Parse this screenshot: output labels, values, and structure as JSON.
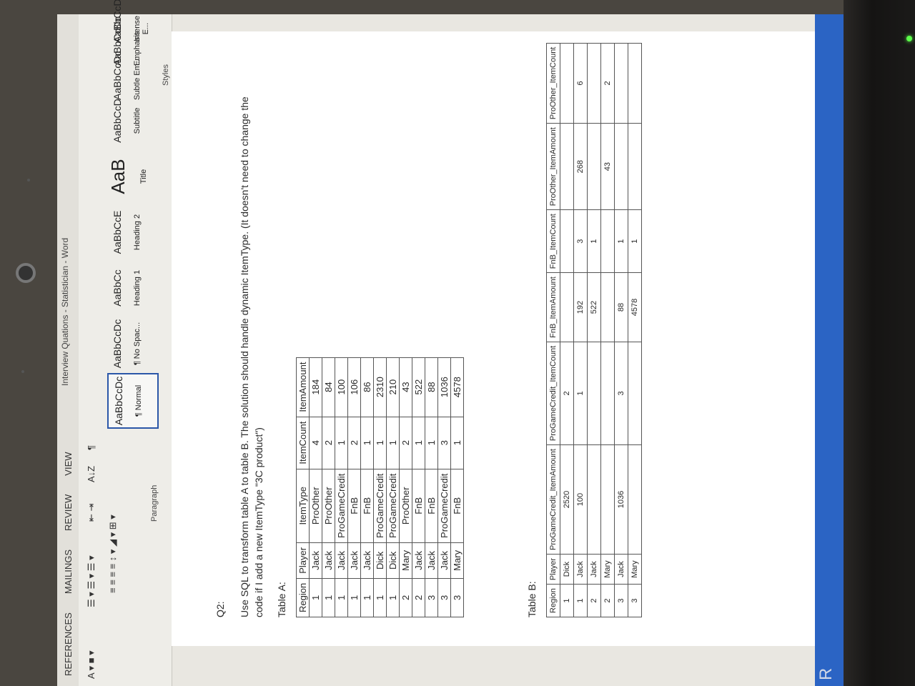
{
  "window": {
    "title": "Interview Quations - Statistician - Word"
  },
  "ribbon": {
    "tabs": [
      "REFERENCES",
      "MAILINGS",
      "REVIEW",
      "VIEW"
    ],
    "groups": {
      "paragraph": "Paragraph",
      "styles": "Styles"
    },
    "styles": [
      {
        "sample": "AaBbCcDc",
        "name": "¶ Normal"
      },
      {
        "sample": "AaBbCcDc",
        "name": "¶ No Spac..."
      },
      {
        "sample": "AaBbCc",
        "name": "Heading 1"
      },
      {
        "sample": "AaBbCcE",
        "name": "Heading 2"
      },
      {
        "sample": "AaB",
        "name": "Title"
      },
      {
        "sample": "AaBbCcD",
        "name": "Subtitle"
      },
      {
        "sample": "AaBbCcDc",
        "name": "Subtle Em..."
      },
      {
        "sample": "AaBbCcDc",
        "name": "Emphasis"
      },
      {
        "sample": "AaBbCcDc",
        "name": "Intense E..."
      }
    ]
  },
  "document": {
    "question_label": "Q2:",
    "question_text": "Use SQL to transform table A to table B. The solution should handle dynamic ItemType. (It doesn't need to change the code if I add a new ItemType \"3C product\")",
    "table_a_label": "Table A:",
    "table_b_label": "Table B:",
    "table_a": {
      "headers": [
        "Region",
        "Player",
        "ItemType",
        "ItemCount",
        "ItemAmount"
      ],
      "rows": [
        [
          "1",
          "Jack",
          "ProOther",
          "4",
          "184"
        ],
        [
          "1",
          "Jack",
          "ProOther",
          "2",
          "84"
        ],
        [
          "1",
          "Jack",
          "ProGameCredit",
          "1",
          "100"
        ],
        [
          "1",
          "Jack",
          "FnB",
          "2",
          "106"
        ],
        [
          "1",
          "Jack",
          "FnB",
          "1",
          "86"
        ],
        [
          "1",
          "Dick",
          "ProGameCredit",
          "1",
          "2310"
        ],
        [
          "1",
          "Dick",
          "ProGameCredit",
          "1",
          "210"
        ],
        [
          "2",
          "Mary",
          "ProOther",
          "2",
          "43"
        ],
        [
          "2",
          "Jack",
          "FnB",
          "1",
          "522"
        ],
        [
          "3",
          "Jack",
          "FnB",
          "1",
          "88"
        ],
        [
          "3",
          "Jack",
          "ProGameCredit",
          "3",
          "1036"
        ],
        [
          "3",
          "Mary",
          "FnB",
          "1",
          "4578"
        ]
      ]
    },
    "table_b": {
      "headers": [
        "Region",
        "Player",
        "ProGameCredit_ItemAmount",
        "ProGameCredit_ItemCount",
        "FnB_ItemAmount",
        "FnB_ItemCount",
        "ProOther_ItemAmount",
        "ProOther_ItemCount"
      ],
      "rows": [
        [
          "1",
          "Dick",
          "2520",
          "2",
          "",
          "",
          "",
          ""
        ],
        [
          "1",
          "Jack",
          "100",
          "1",
          "192",
          "3",
          "268",
          "6"
        ],
        [
          "2",
          "Jack",
          "",
          "",
          "522",
          "1",
          "",
          ""
        ],
        [
          "2",
          "Mary",
          "",
          "",
          "",
          "",
          "43",
          "2"
        ],
        [
          "3",
          "Jack",
          "1036",
          "3",
          "88",
          "1",
          "",
          ""
        ],
        [
          "3",
          "Mary",
          "",
          "",
          "4578",
          "1",
          "",
          ""
        ]
      ]
    }
  }
}
